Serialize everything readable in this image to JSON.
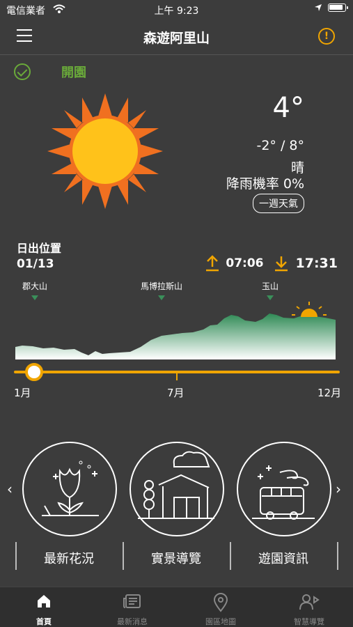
{
  "status_bar": {
    "carrier": "電信業者",
    "time": "上午 9:23"
  },
  "nav": {
    "title": "森遊阿里山"
  },
  "park_status": {
    "label": "開園"
  },
  "weather": {
    "temperature": "4°",
    "range": "-2° / 8°",
    "condition": "晴",
    "rain_chance": "降雨機率 0%",
    "week_button": "一週天氣"
  },
  "sunrise": {
    "label": "日出位置",
    "date": "01/13",
    "sunrise_time": "07:06",
    "sunset_time": "17:31"
  },
  "mountains": [
    "郡大山",
    "馬博拉斯山",
    "玉山"
  ],
  "timeline": {
    "start": "1月",
    "mid": "7月",
    "end": "12月",
    "position": 0.07
  },
  "features": [
    "最新花況",
    "實景導覽",
    "遊園資訊"
  ],
  "tabs": [
    "首頁",
    "最新消息",
    "園區地圖",
    "智慧導覽"
  ],
  "colors": {
    "accent": "#f0a500",
    "green": "#6aaa3a",
    "mountain": "#3a8f5a",
    "background": "#3c3c3c"
  }
}
